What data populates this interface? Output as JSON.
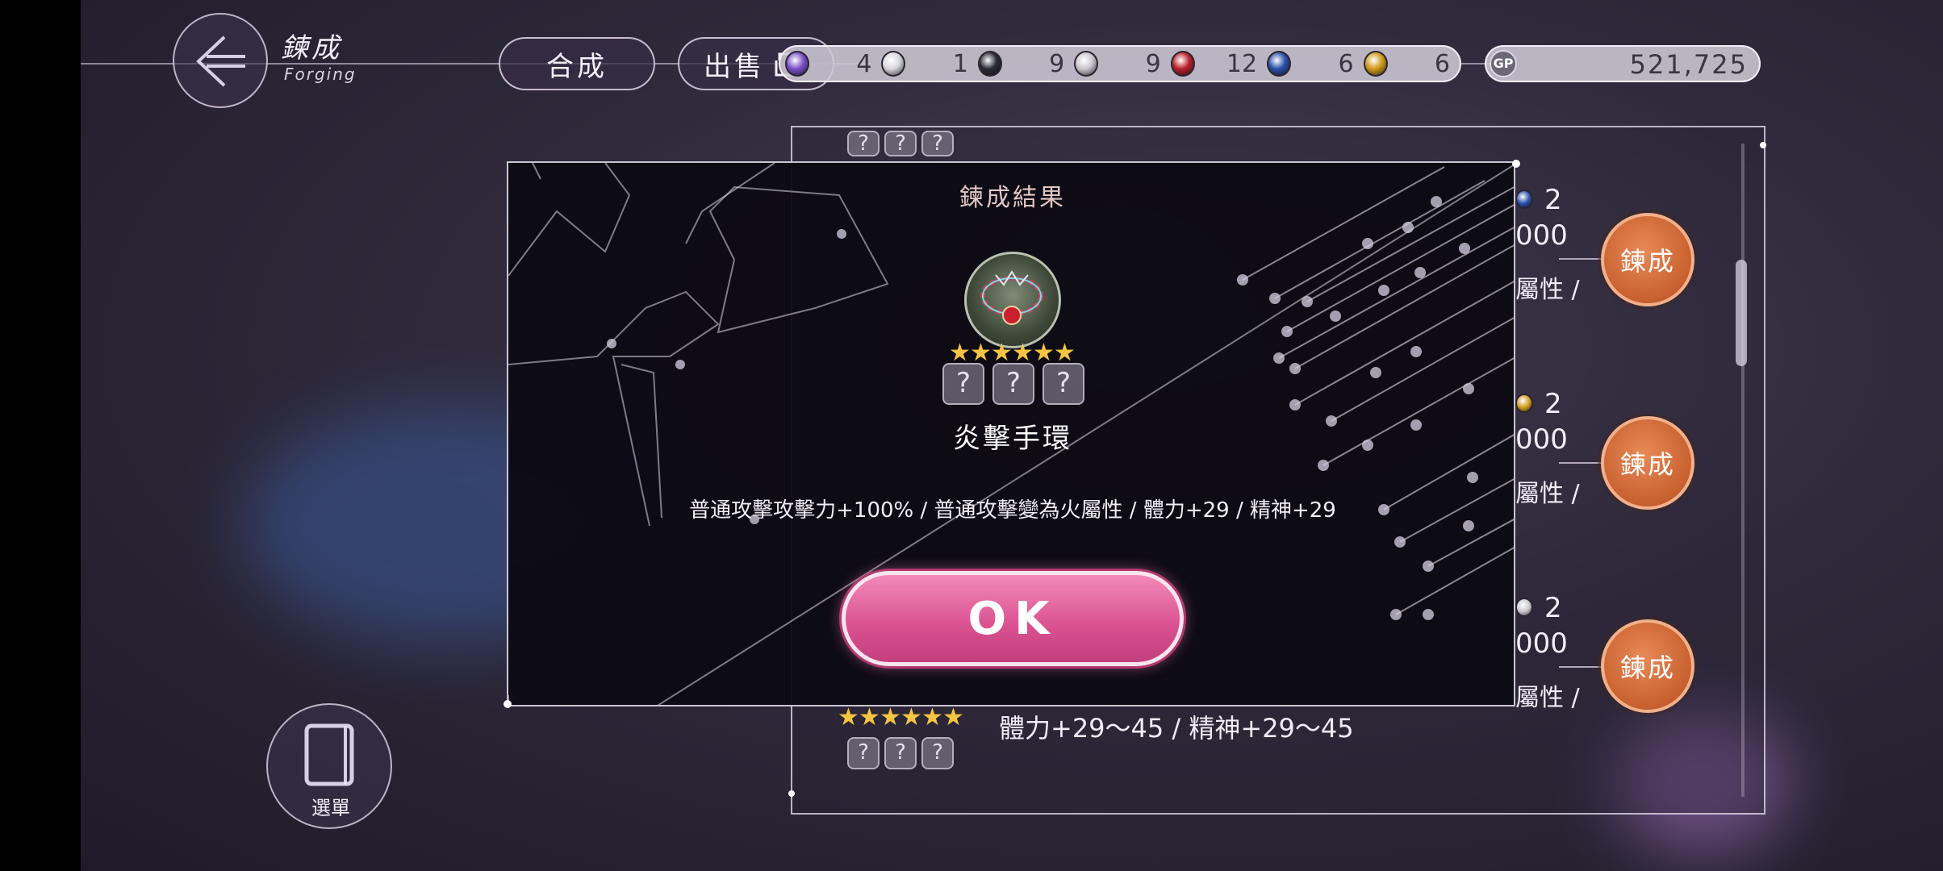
{
  "header": {
    "title": "鍊成",
    "subtitle": "Forging",
    "back_icon": "arrow-left-icon",
    "synthesis_label": "合成",
    "sell_label": "出售"
  },
  "resources": [
    {
      "icon": "purple-gem-icon",
      "color": "#7a4fc8",
      "count": "4"
    },
    {
      "icon": "diamond-icon",
      "color": "#d8d6dc",
      "count": "1"
    },
    {
      "icon": "black-gem-icon",
      "color": "#2a2a34",
      "count": "9"
    },
    {
      "icon": "white-gem-icon",
      "color": "#c8c6cc",
      "count": "9"
    },
    {
      "icon": "red-gem-icon",
      "color": "#b8202a",
      "count": "12"
    },
    {
      "icon": "blue-gem-icon",
      "color": "#2a4ea8",
      "count": "6"
    },
    {
      "icon": "yellow-gem-icon",
      "color": "#d09a1a",
      "count": "6"
    }
  ],
  "gold": {
    "icon": "gp-coin-icon",
    "icon_text": "GP",
    "value": "521,725"
  },
  "list": {
    "forge_label": "鍊成",
    "rows": [
      {
        "gem_color": "#2a4ea8",
        "gem_count": "2",
        "cost_fragment": "000",
        "attr_fragment": "屬性 /"
      },
      {
        "gem_color": "#d09a1a",
        "gem_count": "2",
        "cost_fragment": "000",
        "attr_fragment": "屬性 /"
      },
      {
        "gem_color": "#c8c6cc",
        "gem_count": "2",
        "cost_fragment": "000",
        "attr_fragment": "屬性 /"
      }
    ],
    "bottom_stats": "體力+29～45 / 精神+29～45",
    "question_mark": "?"
  },
  "menu": {
    "label": "選單"
  },
  "dialog": {
    "title": "鍊成結果",
    "item_name": "炎擊手環",
    "stars": 6,
    "description": "普通攻擊攻擊力+100% / 普通攻擊變為火屬性 / 體力+29 / 精神+29",
    "ok_label": "OK"
  },
  "colors": {
    "accent_pink": "#d9508f",
    "forge_orange": "#c8602f",
    "star_gold": "#f5c442"
  }
}
